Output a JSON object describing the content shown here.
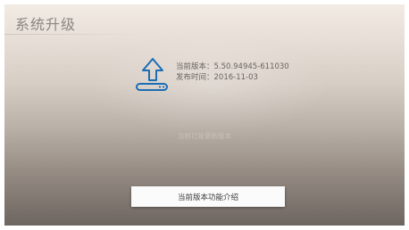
{
  "page": {
    "title": "系统升级"
  },
  "version": {
    "current_label": "当前版本：",
    "current_value": "5.50.94945-611030",
    "release_label": "发布时间：",
    "release_value": "2016-11-03"
  },
  "status": {
    "message": "当前已是最新版本"
  },
  "actions": {
    "feature_button_label": "当前版本功能介绍"
  },
  "icons": {
    "upgrade": "upload-arrow-icon"
  },
  "colors": {
    "accent": "#1b6db5"
  }
}
